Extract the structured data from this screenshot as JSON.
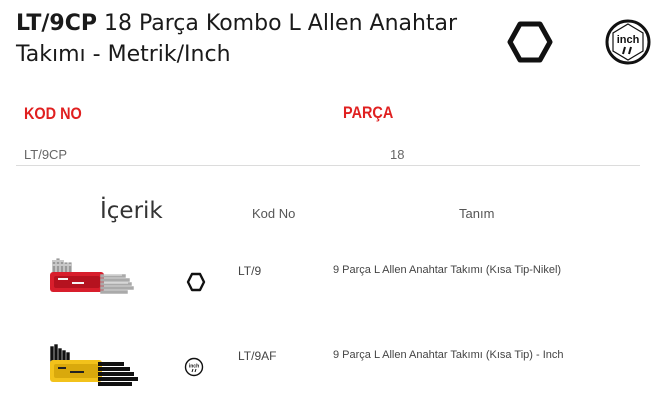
{
  "product": {
    "code": "LT/9CP",
    "name": "18 Parça Kombo L Allen Anahtar",
    "name_line2": "Takımı - Metrik/Inch"
  },
  "icons": {
    "hex": "hexagon-metric-icon",
    "inch": "inch-badge-icon",
    "inch_label": "inch"
  },
  "spec_table": {
    "headers": {
      "kod_no": "KOD NO",
      "parca": "PARÇA"
    },
    "rows": [
      {
        "kod_no": "LT/9CP",
        "parca": "18"
      }
    ]
  },
  "contents": {
    "title": "İçerik",
    "headers": {
      "kod_no": "Kod No",
      "tanim": "Tanım"
    },
    "items": [
      {
        "kod_no": "LT/9",
        "tanim": "9 Parça L Allen Anahtar Takımı (Kısa Tip-Nikel)",
        "type_icon": "hexagon-metric-icon",
        "image_icon": "nickel-allen-key-set-image"
      },
      {
        "kod_no": "LT/9AF",
        "tanim": "9 Parça L Allen Anahtar Takımı (Kısa Tip) - Inch",
        "type_icon": "inch-badge-icon",
        "image_icon": "black-allen-key-set-image"
      }
    ]
  },
  "colors": {
    "accent": "#e02020",
    "text": "#222222",
    "muted": "#666666",
    "rule": "#dcdcdc"
  }
}
